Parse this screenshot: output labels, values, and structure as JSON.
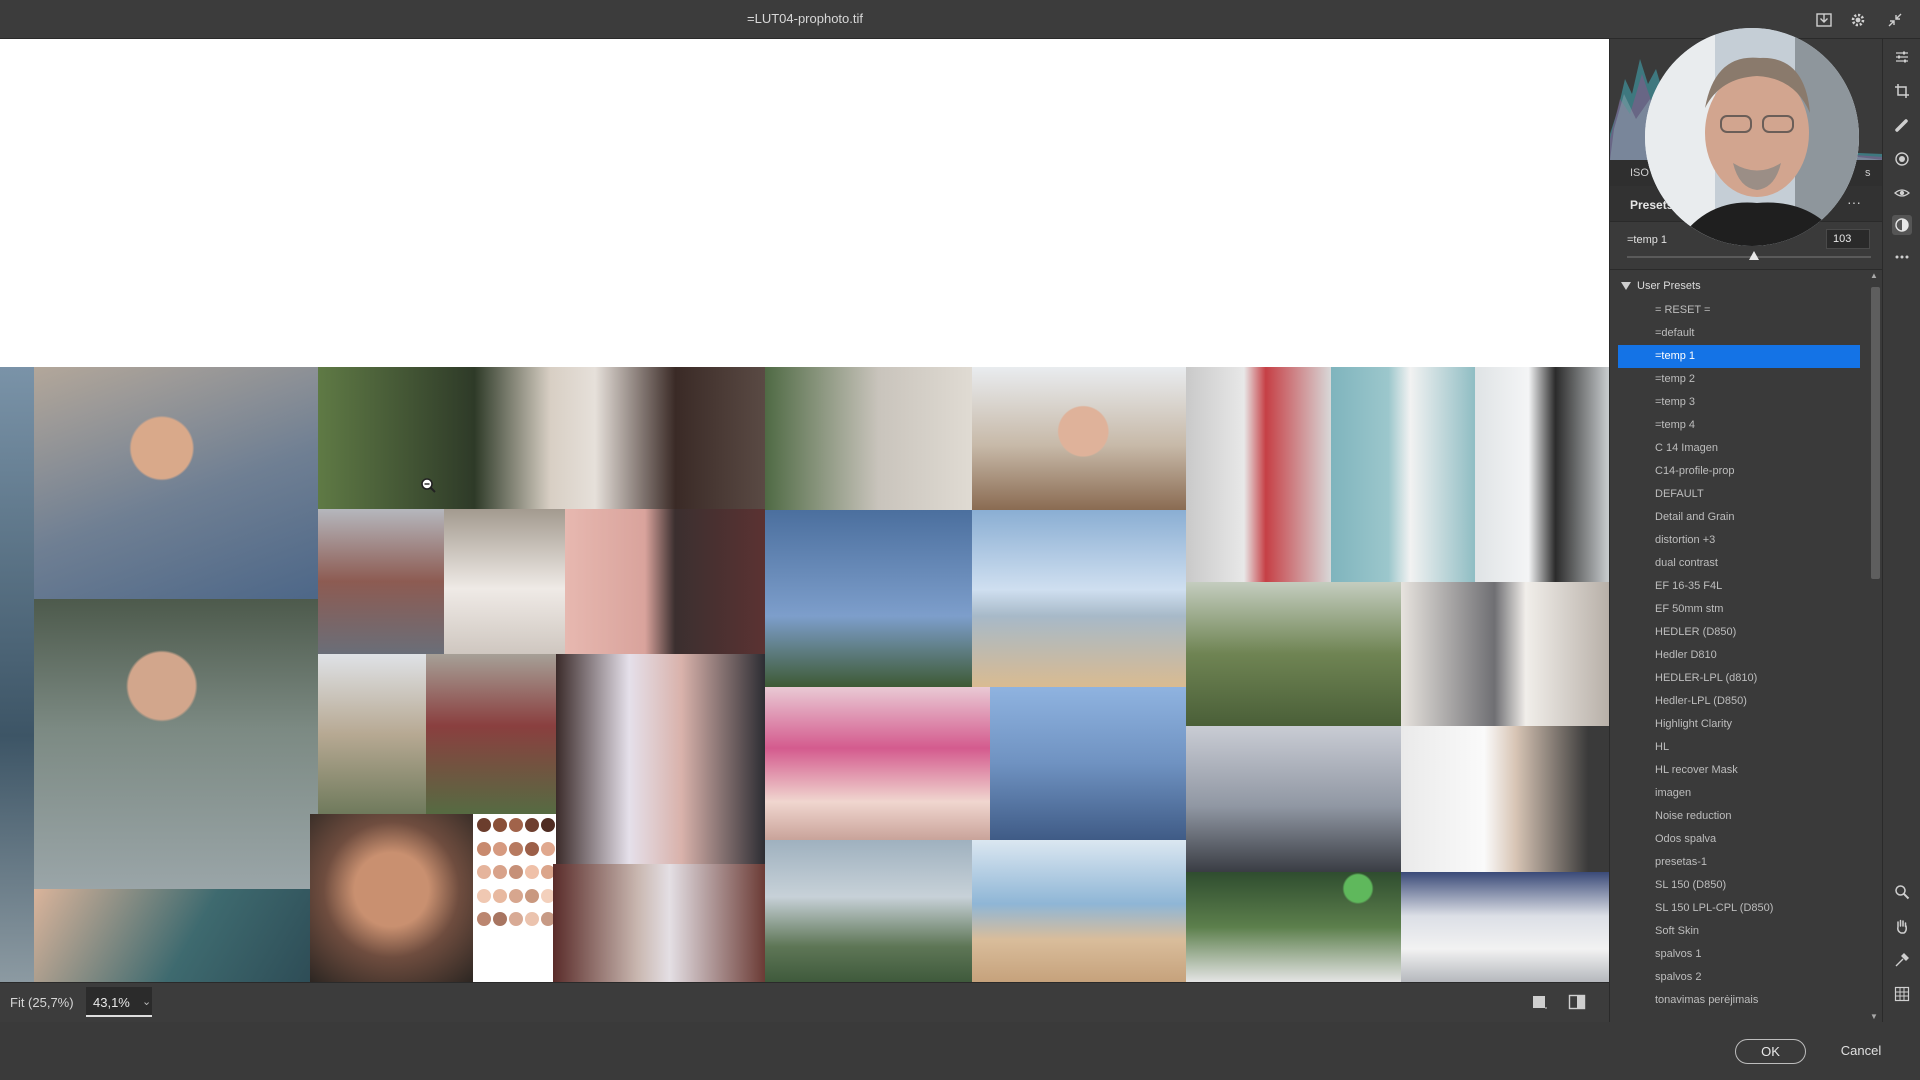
{
  "window": {
    "title": "=LUT04-prophoto.tif"
  },
  "titlebar_icons": [
    "save-icon",
    "gear-icon",
    "collapse-icon"
  ],
  "exif": {
    "iso_label": "ISO",
    "right_label": "s"
  },
  "presets": {
    "header_label": "Presets",
    "more_label": "···",
    "selected_name": "=temp 1",
    "amount_value": "103",
    "amount_fraction": 0.52,
    "group_label": "User Presets",
    "items": [
      "= RESET =",
      "=default",
      "=temp 1",
      "=temp 2",
      "=temp 3",
      "=temp 4",
      "C 14 Imagen",
      "C14-profile-prop",
      "DEFAULT",
      "Detail and Grain",
      "distortion +3",
      "dual contrast",
      "EF 16-35 F4L",
      "EF 50mm stm",
      "HEDLER (D850)",
      "Hedler D810",
      "HEDLER-LPL (d810)",
      "Hedler-LPL (D850)",
      "Highlight Clarity",
      "HL",
      "HL recover Mask",
      "imagen",
      "Noise reduction",
      "Odos spalva",
      "presetas-1",
      "SL 150 (D850)",
      "SL 150 LPL-CPL (D850)",
      "Soft Skin",
      "spalvos 1",
      "spalvos 2",
      "tonavimas perėjimais"
    ],
    "active_index": 2
  },
  "statusbar": {
    "fit_label": "Fit (25,7%)",
    "zoom_value": "43,1%"
  },
  "actions": {
    "ok_label": "OK",
    "cancel_label": "Cancel"
  },
  "colors": {
    "accent": "#1473e6",
    "panel": "#3a3a3a",
    "canvas": "#ffffff"
  }
}
